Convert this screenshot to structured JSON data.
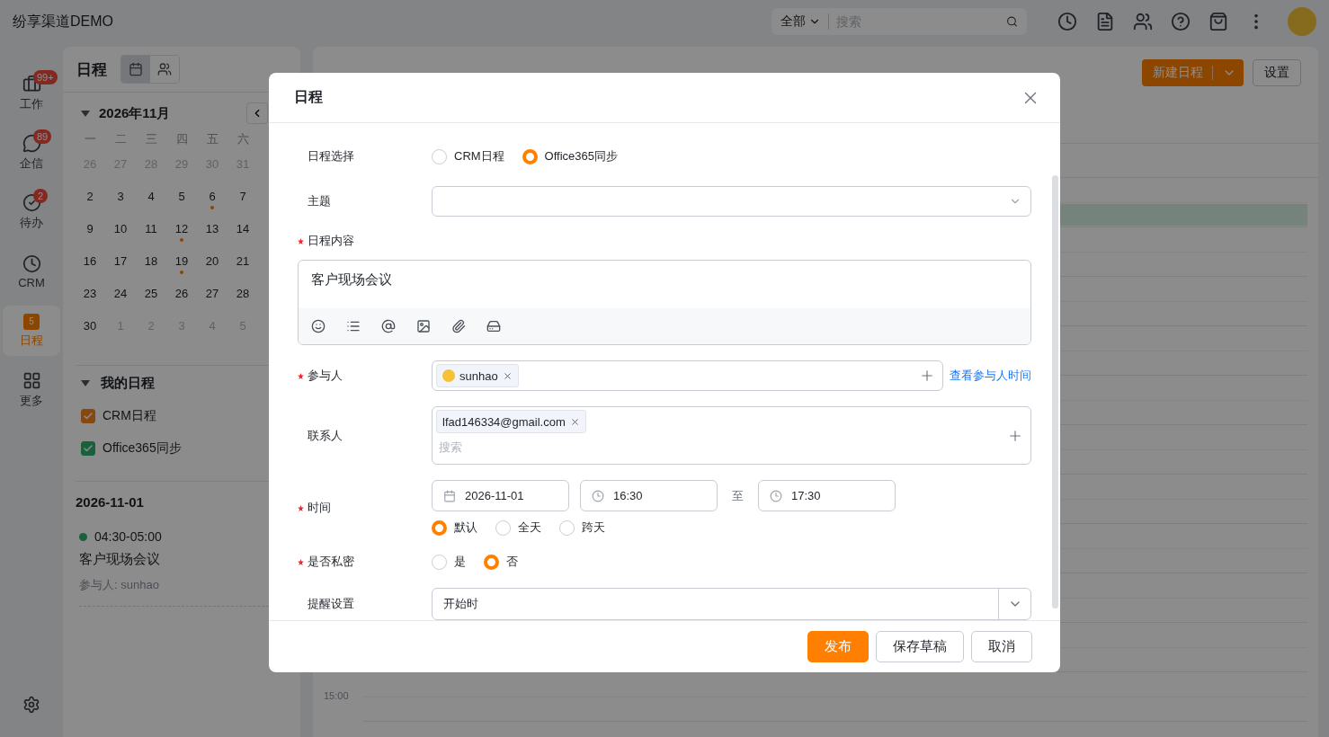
{
  "app": {
    "title": "纷享渠道DEMO"
  },
  "topbar": {
    "scope": "全部",
    "search_placeholder": "搜索"
  },
  "nav": [
    {
      "label": "工作",
      "badge": "99+",
      "selected": false
    },
    {
      "label": "企信",
      "badge": "89",
      "selected": false
    },
    {
      "label": "待办",
      "badge": "2",
      "selected": false
    },
    {
      "label": "CRM",
      "selected": false
    },
    {
      "label": "日程",
      "icon_text": "5",
      "selected": true
    },
    {
      "label": "更多",
      "selected": false
    }
  ],
  "calendar": {
    "title": "日程",
    "view_tabs": [
      {
        "selected": true
      },
      {
        "selected": false
      }
    ],
    "month": "2026年11月",
    "weekdays": [
      "一",
      "二",
      "三",
      "四",
      "五",
      "六"
    ],
    "weeks": [
      [
        {
          "day": "26",
          "muted": true,
          "dot": false
        },
        {
          "day": "27",
          "muted": true,
          "dot": false
        },
        {
          "day": "28",
          "muted": true,
          "dot": false
        },
        {
          "day": "29",
          "muted": true,
          "dot": false
        },
        {
          "day": "30",
          "muted": true,
          "dot": false
        },
        {
          "day": "31",
          "muted": true,
          "dot": false
        }
      ],
      [
        {
          "day": "2",
          "muted": false,
          "dot": false
        },
        {
          "day": "3",
          "muted": false,
          "dot": false
        },
        {
          "day": "4",
          "muted": false,
          "dot": false
        },
        {
          "day": "5",
          "muted": false,
          "dot": false
        },
        {
          "day": "6",
          "muted": false,
          "dot": true
        },
        {
          "day": "7",
          "muted": false,
          "dot": false
        }
      ],
      [
        {
          "day": "9",
          "muted": false,
          "dot": false
        },
        {
          "day": "10",
          "muted": false,
          "dot": false
        },
        {
          "day": "11",
          "muted": false,
          "dot": false
        },
        {
          "day": "12",
          "muted": false,
          "dot": true
        },
        {
          "day": "13",
          "muted": false,
          "dot": false
        },
        {
          "day": "14",
          "muted": false,
          "dot": false
        }
      ],
      [
        {
          "day": "16",
          "muted": false,
          "dot": false
        },
        {
          "day": "17",
          "muted": false,
          "dot": false
        },
        {
          "day": "18",
          "muted": false,
          "dot": false
        },
        {
          "day": "19",
          "muted": false,
          "dot": true
        },
        {
          "day": "20",
          "muted": false,
          "dot": false
        },
        {
          "day": "21",
          "muted": false,
          "dot": false
        }
      ],
      [
        {
          "day": "23",
          "muted": false,
          "dot": false
        },
        {
          "day": "24",
          "muted": false,
          "dot": false
        },
        {
          "day": "25",
          "muted": false,
          "dot": false
        },
        {
          "day": "26",
          "muted": false,
          "dot": false
        },
        {
          "day": "27",
          "muted": false,
          "dot": false
        },
        {
          "day": "28",
          "muted": false,
          "dot": false
        }
      ],
      [
        {
          "day": "30",
          "muted": false,
          "dot": false
        },
        {
          "day": "1",
          "muted": true,
          "dot": false
        },
        {
          "day": "2",
          "muted": true,
          "dot": false
        },
        {
          "day": "3",
          "muted": true,
          "dot": false
        },
        {
          "day": "4",
          "muted": true,
          "dot": false
        },
        {
          "day": "5",
          "muted": true,
          "dot": false
        }
      ]
    ]
  },
  "my_calendars": {
    "title": "我的日程",
    "items": [
      {
        "label": "CRM日程",
        "checked": true,
        "color": "#874811"
      },
      {
        "label": "Office365同步",
        "checked": true,
        "color": "#1a613c"
      }
    ]
  },
  "agenda": {
    "date": "2026-11-01",
    "events": [
      {
        "time": "04:30-05:00",
        "title": "客户现场会议",
        "participants": "参与人: sunhao",
        "color": "#1a613c"
      }
    ]
  },
  "main": {
    "new_button": "新建日程",
    "settings_button": "设置",
    "time_label": "15:00"
  },
  "dialog": {
    "title": "日程",
    "source": {
      "label": "日程选择",
      "required": false,
      "options": [
        {
          "label": "CRM日程",
          "selected": false
        },
        {
          "label": "Office365同步",
          "selected": true
        }
      ]
    },
    "subject": {
      "label": "主题",
      "required": false
    },
    "content": {
      "label": "日程内容",
      "required": true,
      "value": "客户现场会议"
    },
    "participants": {
      "label": "参与人",
      "required": true,
      "tags": [
        "sunhao"
      ],
      "link": "查看参与人时间"
    },
    "contacts": {
      "label": "联系人",
      "required": false,
      "tags": [
        "lfad146334@gmail.com"
      ],
      "placeholder": "搜索"
    },
    "time": {
      "label": "时间",
      "required": true,
      "date": "2026-11-01",
      "start": "16:30",
      "separator": "至",
      "end": "17:30",
      "options": [
        {
          "label": "默认",
          "selected": true
        },
        {
          "label": "全天",
          "selected": false
        },
        {
          "label": "跨天",
          "selected": false
        }
      ]
    },
    "private": {
      "label": "是否私密",
      "required": true,
      "options": [
        {
          "label": "是",
          "selected": false
        },
        {
          "label": "否",
          "selected": true
        }
      ]
    },
    "reminder": {
      "label": "提醒设置",
      "required": false,
      "value": "开始时"
    },
    "buttons": [
      {
        "label": "发布",
        "kind": "primary"
      },
      {
        "label": "保存草稿",
        "kind": "default"
      },
      {
        "label": "取消",
        "kind": "default"
      }
    ]
  }
}
